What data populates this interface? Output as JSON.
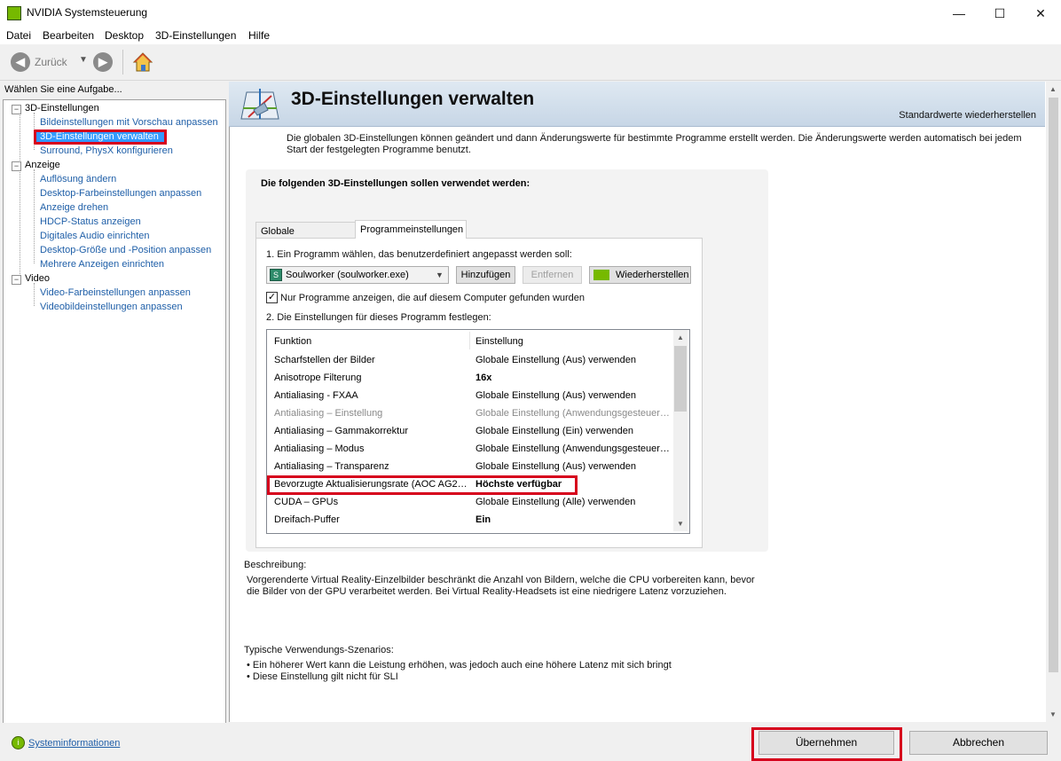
{
  "window": {
    "title": "NVIDIA Systemsteuerung"
  },
  "window_controls": {
    "minimize": "—",
    "maximize": "☐",
    "close": "✕"
  },
  "menu": [
    "Datei",
    "Bearbeiten",
    "Desktop",
    "3D-Einstellungen",
    "Hilfe"
  ],
  "toolbar": {
    "back_label": "Zurück"
  },
  "left": {
    "heading": "Wählen Sie eine Aufgabe...",
    "categories": [
      {
        "label": "3D-Einstellungen",
        "items": [
          "Bildeinstellungen mit Vorschau anpassen",
          "3D-Einstellungen verwalten",
          "Surround, PhysX konfigurieren"
        ]
      },
      {
        "label": "Anzeige",
        "items": [
          "Auflösung ändern",
          "Desktop-Farbeinstellungen anpassen",
          "Anzeige drehen",
          "HDCP-Status anzeigen",
          "Digitales Audio einrichten",
          "Desktop-Größe und -Position anpassen",
          "Mehrere Anzeigen einrichten"
        ]
      },
      {
        "label": "Video",
        "items": [
          "Video-Farbeinstellungen anpassen",
          "Videobildeinstellungen anpassen"
        ]
      }
    ],
    "selected_item": "3D-Einstellungen verwalten",
    "sysinfo_link": "Systeminformationen"
  },
  "header": {
    "title": "3D-Einstellungen verwalten",
    "restore_defaults": "Standardwerte wiederherstellen"
  },
  "intro_text": "Die globalen 3D-Einstellungen können geändert und dann Änderungswerte für bestimmte Programme erstellt werden. Die Änderungswerte werden automatisch bei jedem Start der festgelegten Programme benutzt.",
  "group_title": "Die folgenden 3D-Einstellungen sollen verwendet werden:",
  "tabs": [
    {
      "label": "Globale Einstellungen"
    },
    {
      "label": "Programmeinstellungen"
    }
  ],
  "active_tab": "Programmeinstellungen",
  "program": {
    "step1_label": "1. Ein Programm wählen, das benutzerdefiniert angepasst werden soll:",
    "selected": "Soulworker (soulworker.exe)",
    "add_button": "Hinzufügen",
    "remove_button": "Entfernen",
    "restore_button": "Wiederherstellen",
    "checkbox_label": "Nur Programme anzeigen, die auf diesem Computer gefunden wurden",
    "checkbox_checked": true,
    "step2_label": "2. Die Einstellungen für dieses Programm festlegen:"
  },
  "settings_table": {
    "columns": [
      "Funktion",
      "Einstellung"
    ],
    "rows": [
      {
        "f": "Scharfstellen der Bilder",
        "s": "Globale Einstellung (Aus) verwenden",
        "bold": false,
        "dim": false,
        "highlight": false
      },
      {
        "f": "Anisotrope Filterung",
        "s": "16x",
        "bold": true,
        "dim": false,
        "highlight": false
      },
      {
        "f": "Antialiasing - FXAA",
        "s": "Globale Einstellung (Aus) verwenden",
        "bold": false,
        "dim": false,
        "highlight": false
      },
      {
        "f": "Antialiasing – Einstellung",
        "s": "Globale Einstellung (Anwendungsgesteuer…",
        "bold": false,
        "dim": true,
        "highlight": false
      },
      {
        "f": "Antialiasing – Gammakorrektur",
        "s": "Globale Einstellung (Ein) verwenden",
        "bold": false,
        "dim": false,
        "highlight": false
      },
      {
        "f": "Antialiasing – Modus",
        "s": "Globale Einstellung (Anwendungsgesteuer…",
        "bold": false,
        "dim": false,
        "highlight": false
      },
      {
        "f": "Antialiasing – Transparenz",
        "s": "Globale Einstellung (Aus) verwenden",
        "bold": false,
        "dim": false,
        "highlight": false
      },
      {
        "f": "Bevorzugte Aktualisierungsrate (AOC AG2…",
        "s": "Höchste verfügbar",
        "bold": true,
        "dim": false,
        "highlight": true
      },
      {
        "f": "CUDA – GPUs",
        "s": "Globale Einstellung (Alle) verwenden",
        "bold": false,
        "dim": false,
        "highlight": false
      },
      {
        "f": "Dreifach-Puffer",
        "s": "Ein",
        "bold": true,
        "dim": false,
        "highlight": false
      }
    ]
  },
  "description": {
    "label": "Beschreibung:",
    "text": "Vorgerenderte Virtual Reality-Einzelbilder beschränkt die Anzahl von Bildern, welche die CPU vorbereiten kann, bevor die Bilder von der GPU verarbeitet werden. Bei Virtual Reality-Headsets ist eine niedrigere Latenz vorzuziehen."
  },
  "usage": {
    "label": "Typische Verwendungs-Szenarios:",
    "items": [
      "Ein höherer Wert kann die Leistung erhöhen, was jedoch auch eine höhere Latenz mit sich bringt",
      "Diese Einstellung gilt nicht für SLI"
    ]
  },
  "bottom": {
    "apply": "Übernehmen",
    "cancel": "Abbrechen"
  },
  "colors": {
    "link": "#1f5fa8",
    "highlight": "#d6001c",
    "nvidia_green": "#76b900",
    "selected_bg": "#3399ff"
  }
}
